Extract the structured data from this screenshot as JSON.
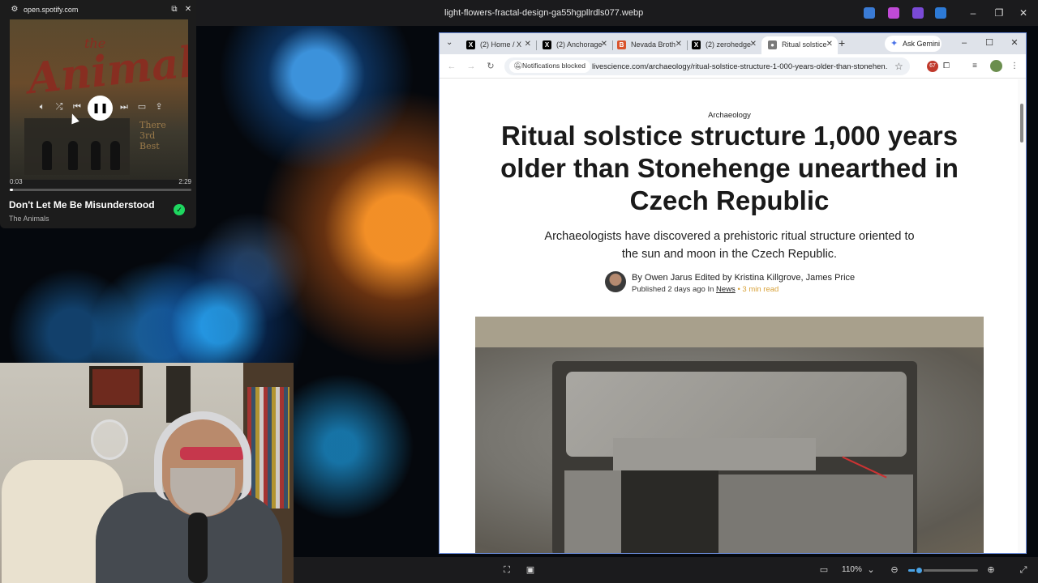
{
  "viewer": {
    "filename": "light-flowers-fractal-design-ga55hgpllrdls077.webp",
    "zoom": "110%",
    "zoom_fraction": 0.15
  },
  "spotify": {
    "site": "open.spotify.com",
    "elapsed": "0:03",
    "duration": "2:29",
    "progress_fraction": 0.02,
    "song": "Don't Let Me Be Misunderstood",
    "artist": "The Animals",
    "album_art": {
      "band_word": "Animals!",
      "the": "the",
      "side_text": "There\n3rd\nBest"
    }
  },
  "browser": {
    "tabs": [
      {
        "label": "(2) Home / X",
        "icon": "x-logo-icon",
        "color": "#000000"
      },
      {
        "label": "(2) Anchorage",
        "icon": "x-logo-icon",
        "color": "#000000"
      },
      {
        "label": "Nevada Broth",
        "icon": "b-logo-icon",
        "color": "#d9532c"
      },
      {
        "label": "(2) zerohedge",
        "icon": "x-logo-icon",
        "color": "#000000"
      },
      {
        "label": "Ritual solstice",
        "icon": "livescience-icon",
        "color": "#7a7a7a"
      }
    ],
    "new_tab": "+",
    "gemini": "Ask Gemini",
    "notifications_chip": "Notifications blocked",
    "url": "livescience.com/archaeology/ritual-solstice-structure-1-000-years-older-than-stonehen...",
    "extension_badge": "67"
  },
  "article": {
    "section": "Archaeology",
    "headline": "Ritual solstice structure 1,000 years older than Stonehenge unearthed in Czech Republic",
    "dek": "Archaeologists have discovered a prehistoric ritual structure oriented to the sun and moon in the Czech Republic.",
    "byline_prefix": "By",
    "author": "Owen Jarus",
    "edited_by": "Edited by Kristina Killgrove, James Price",
    "published_prefix": "Published 2 days ago In",
    "published_section": "News",
    "read_time": "• 3 min read"
  },
  "colors": {
    "accent": "#4aa3e6",
    "spotify_green": "#1ed760",
    "read_time": "#d8a23a"
  }
}
